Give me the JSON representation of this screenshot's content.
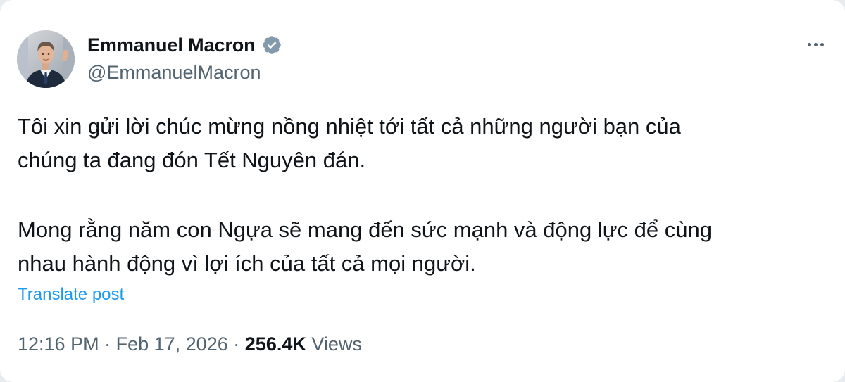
{
  "author": {
    "display_name": "Emmanuel Macron",
    "handle": "@EmmanuelMacron",
    "verified_icon": "verified-badge-icon",
    "verified_color": "#829aab"
  },
  "menu": {
    "more_icon": "more-options-icon"
  },
  "post": {
    "paragraph_1_line_1": "Tôi xin gửi lời chúc mừng nồng nhiệt tới tất cả những người bạn của",
    "paragraph_1_line_2": "chúng ta đang đón Tết Nguyên đán.",
    "paragraph_2_line_1": "Mong rằng năm con Ngựa sẽ mang đến sức mạnh và động lực để cùng",
    "paragraph_2_line_2": "nhau hành động vì lợi ích của tất cả mọi người."
  },
  "translate_label": "Translate post",
  "meta": {
    "time": "12:16 PM",
    "separator": "·",
    "date": "Feb 17, 2026",
    "views_count": "256.4K",
    "views_label": "Views"
  },
  "colors": {
    "text_primary": "#0f1419",
    "text_secondary": "#536471",
    "link": "#1d9bf0"
  }
}
